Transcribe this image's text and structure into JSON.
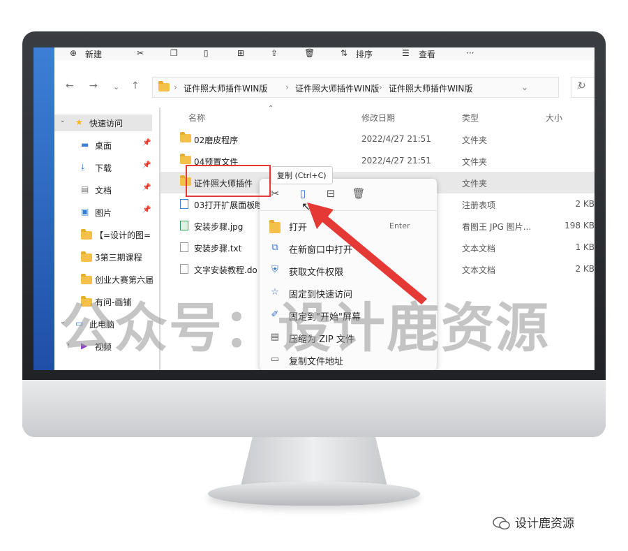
{
  "toolbar": {
    "new_label": "新建",
    "sort_label": "排序",
    "view_label": "查看",
    "more_label": "···"
  },
  "address": {
    "crumbs": [
      "证件照大师插件WIN版",
      "证件照大师插件WIN版",
      "证件照大师插件WIN版"
    ]
  },
  "sidebar": {
    "quick_access": "快速访问",
    "items": [
      {
        "label": "桌面",
        "icon": "desktop-icon"
      },
      {
        "label": "下载",
        "icon": "download-icon"
      },
      {
        "label": "文档",
        "icon": "document-icon"
      },
      {
        "label": "图片",
        "icon": "picture-icon"
      },
      {
        "label": "【=设计的图=",
        "icon": "folder-icon"
      },
      {
        "label": "3第三期课程",
        "icon": "folder-icon"
      },
      {
        "label": "创业大赛第六届",
        "icon": "folder-icon"
      },
      {
        "label": "有问-画铺",
        "icon": "folder-icon"
      }
    ],
    "this_pc": "此电脑",
    "video": "视频"
  },
  "columns": {
    "name": "名称",
    "date": "修改日期",
    "type": "类型",
    "size": "大小"
  },
  "files": [
    {
      "name": "02磨皮程序",
      "date": "2022/4/27 21:51",
      "type": "文件夹",
      "size": ""
    },
    {
      "name": "04预置文件",
      "date": "2022/4/27 21:51",
      "type": "文件夹",
      "size": ""
    },
    {
      "name": "证件照大师插件",
      "date": "",
      "type": "文件夹",
      "size": ""
    },
    {
      "name": "03打开扩展面板睦",
      "date": "",
      "type": "注册表项",
      "size": "2 KB"
    },
    {
      "name": "安装步骤.jpg",
      "date": "",
      "type": "看图王 JPG 图片...",
      "size": "198 KB"
    },
    {
      "name": "安装步骤.txt",
      "date": "",
      "type": "文本文档",
      "size": "1 KB"
    },
    {
      "name": "文字安装教程.do",
      "date": "",
      "type": "文本文档",
      "size": "2 KB"
    }
  ],
  "tooltip": "复制 (Ctrl+C)",
  "context_menu": {
    "items": [
      {
        "label": "打开",
        "shortcut": "Enter"
      },
      {
        "label": "在新窗口中打开",
        "shortcut": ""
      },
      {
        "label": "获取文件权限",
        "shortcut": ""
      },
      {
        "label": "固定到快速访问",
        "shortcut": ""
      },
      {
        "label": "固定到\"开始\"屏幕",
        "shortcut": ""
      },
      {
        "label": "压缩为 ZIP 文件",
        "shortcut": ""
      },
      {
        "label": "复制文件地址",
        "shortcut": ""
      }
    ]
  },
  "watermark": "公众号：设计鹿资源",
  "credit": "设计鹿资源",
  "colors": {
    "highlight_red": "#e53935",
    "folder": "#f5c04a"
  }
}
